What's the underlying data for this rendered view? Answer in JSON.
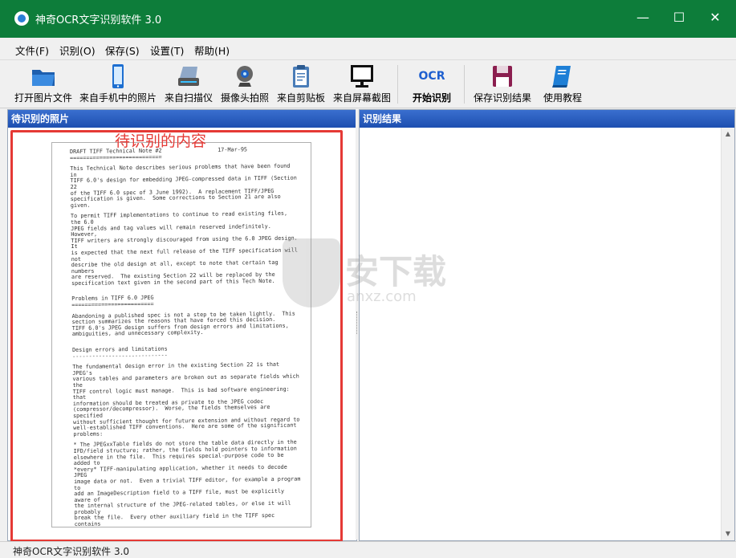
{
  "window": {
    "title": "神奇OCR文字识别软件 3.0",
    "minimize": "—",
    "maximize": "☐",
    "close": "✕"
  },
  "menu": [
    "文件(F)",
    "识别(O)",
    "保存(S)",
    "设置(T)",
    "帮助(H)"
  ],
  "toolbar": {
    "open": "打开图片文件",
    "phone": "来自手机中的照片",
    "scanner": "来自扫描仪",
    "camera": "摄像头拍照",
    "clipboard": "来自剪贴板",
    "screenshot": "来自屏幕截图",
    "ocr_icon": "OCR",
    "start": "开始识别",
    "save": "保存识别结果",
    "tutorial": "使用教程"
  },
  "left_panel": {
    "title": "待识别的照片",
    "annotation": "待识别的内容"
  },
  "right_panel": {
    "title": "识别结果"
  },
  "document": {
    "lines": [
      "DRAFT TIFF Technical Note #2                 17-Mar-95",
      "============================",
      "",
      "This Technical Note describes serious problems that have been found",
      "in",
      "TIFF 6.0's design for embedding JPEG-compressed data in TIFF (Section",
      "22",
      "of the TIFF 6.0 spec of 3 June 1992).  A replacement TIFF/JPEG",
      "specification is given.  Some corrections to Section 21 are also",
      "given.",
      "",
      "To permit TIFF implementations to continue to read existing files,",
      "the 6.0",
      "JPEG fields and tag values will remain reserved indefinitely.",
      "However,",
      "TIFF writers are strongly discouraged from using the 6.0 JPEG design.",
      "It",
      "is expected that the next full release of the TIFF specification will",
      "not",
      "describe the old design at all, except to note that certain tag",
      "numbers",
      "are reserved.  The existing Section 22 will be replaced by the",
      "specification text given in the second part of this Tech Note.",
      "",
      "",
      "Problems in TIFF 6.0 JPEG",
      "=========================",
      "",
      "Abandoning a published spec is not a step to be taken lightly.  This",
      "section summarizes the reasons that have forced this decision.",
      "TIFF 6.0's JPEG design suffers from design errors and limitations,",
      "ambiguities, and unnecessary complexity.",
      "",
      "",
      "Design errors and limitations",
      "-----------------------------",
      "",
      "The fundamental design error in the existing Section 22 is that",
      "JPEG's",
      "various tables and parameters are broken out as separate fields which",
      "the",
      "TIFF control logic must manage.  This is bad software engineering:",
      "that",
      "information should be treated as private to the JPEG codec",
      "(compressor/decompressor).  Worse, the fields themselves are",
      "specified",
      "without sufficient thought for future extension and without regard to",
      "well-established TIFF conventions.  Here are some of the significant",
      "problems:",
      "",
      "* The JPEGxxTable fields do not store the table data directly in the",
      "IFD/field structure; rather, the fields hold pointers to information",
      "elsewhere in the file.  This requires special-purpose code to be",
      "added to",
      "*every* TIFF-manipulating application, whether it needs to decode",
      "JPEG",
      "image data or not.  Even a trivial TIFF editor, for example a program",
      "to",
      "add an ImageDescription field to a TIFF file, must be explicitly",
      "aware of",
      "the internal structure of the JPEG-related tables, or else it will",
      "probably",
      "break the file.  Every other auxiliary field in the TIFF spec",
      "contains"
    ]
  },
  "watermark": {
    "text": "安下载",
    "sub": "anxz.com"
  },
  "status": {
    "text": "神奇OCR文字识别软件 3.0"
  },
  "colors": {
    "titlebar": "#0d7d3a",
    "panel_header": "#1d4fb0",
    "highlight": "#e53935"
  }
}
